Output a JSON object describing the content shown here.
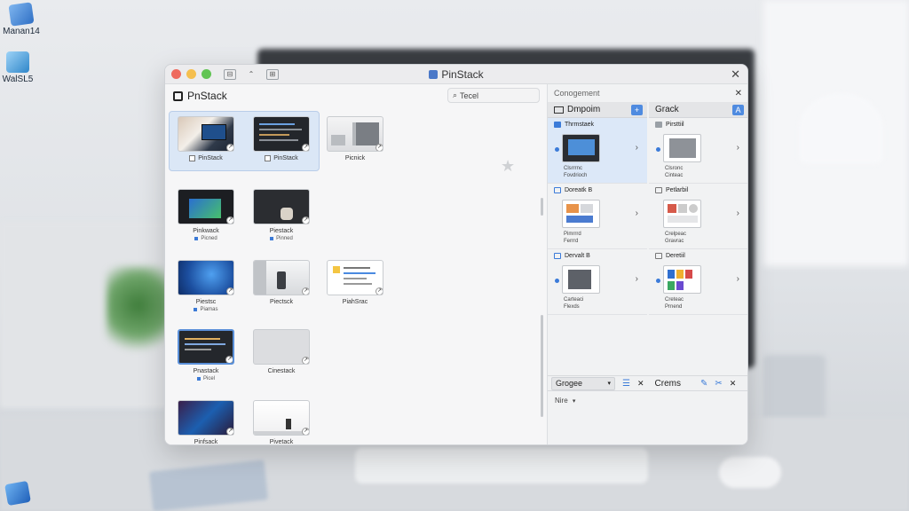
{
  "desktop": {
    "icons": [
      {
        "label": "Manan14",
        "icon": "computer-icon",
        "color": "#4a8fe0"
      },
      {
        "label": "WalSL5",
        "icon": "folder-icon",
        "color": "#3c9bd6"
      },
      {
        "label": "",
        "icon": "box-icon",
        "color": "#2f7fd8"
      }
    ]
  },
  "window": {
    "title": "PinStack",
    "traffic_colors": [
      "#ee6a5e",
      "#f5bf4f",
      "#61c454"
    ],
    "toolbar_glyphs": [
      "⊟",
      "⌃",
      "⊞"
    ],
    "close_glyph": "✕"
  },
  "left": {
    "app_name": "PnStack",
    "search_placeholder": "Tecel",
    "search_icon": "search-icon",
    "rows": [
      {
        "items": [
          {
            "caption": "PinStack",
            "checkbox": true,
            "theme": "photo-desk"
          },
          {
            "caption": "PinStack",
            "checkbox": true,
            "theme": "code-dark"
          },
          {
            "caption": "Picnick",
            "checkbox": false,
            "theme": "office"
          }
        ]
      },
      {
        "items": [
          {
            "caption": "Pinkwack",
            "sub": "Picned",
            "theme": "dark-screen"
          },
          {
            "caption": "Piestack",
            "sub": "Pinned",
            "theme": "hand-dark"
          }
        ]
      },
      {
        "items": [
          {
            "caption": "Piestsc",
            "sub": "Piamas",
            "theme": "windows-blue"
          },
          {
            "caption": "Piectsck",
            "theme": "meeting"
          },
          {
            "caption": "PiahSrac",
            "theme": "document"
          }
        ]
      },
      {
        "items": [
          {
            "caption": "Pnastack",
            "sub": "Picel",
            "theme": "code-dark-selected"
          },
          {
            "caption": "Cinestack",
            "theme": "blank"
          }
        ]
      },
      {
        "items": [
          {
            "caption": "Pinfsack",
            "theme": "windows-purple"
          },
          {
            "caption": "Pivetack",
            "theme": "white-room"
          }
        ]
      }
    ]
  },
  "right": {
    "header": "Conogement",
    "columns": [
      {
        "title": "Dmpoim",
        "cards": [
          {
            "title": "Thrmstaek",
            "meta1": "Clsrrrnc",
            "meta2": "Fovdrioch",
            "selected": true,
            "theme": "tablet-dark"
          },
          {
            "title": "Doreatk B",
            "meta1": "Pimrrrd",
            "meta2": "Ferrrd",
            "selected": false,
            "theme": "tablet-orange"
          },
          {
            "title": "Dervalt B",
            "meta1": "Carteaci",
            "meta2": "Flexds",
            "selected": false,
            "theme": "tablet-office"
          }
        ]
      },
      {
        "title": "Grack",
        "cards": [
          {
            "title": "Pirsttiil",
            "meta1": "Clsronc",
            "meta2": "Cinteac",
            "selected": false,
            "theme": "tablet-gray"
          },
          {
            "title": "Petlarbil",
            "meta1": "Crelpeac",
            "meta2": "Gravrac",
            "selected": false,
            "theme": "tablet-apps"
          },
          {
            "title": "Deretiil",
            "meta1": "Creteac",
            "meta2": "Prnend",
            "selected": false,
            "theme": "tablet-colors"
          }
        ]
      }
    ],
    "bottom": {
      "dropdown": "Grogee",
      "label": "Crems",
      "filter_value": "Nire"
    }
  }
}
